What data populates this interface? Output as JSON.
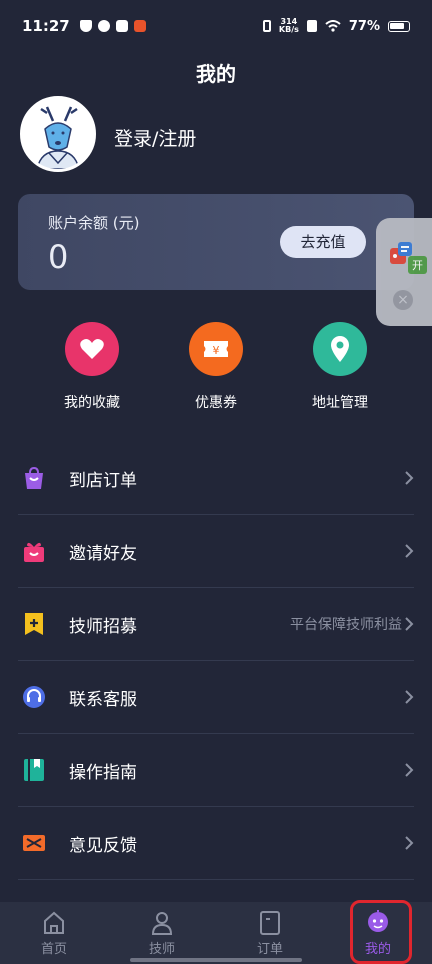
{
  "status_bar": {
    "time": "11:27",
    "net_speed_value": "314",
    "net_speed_unit": "KB/s",
    "battery": "77%"
  },
  "header": {
    "title": "我的"
  },
  "profile": {
    "login_label": "登录/注册"
  },
  "balance": {
    "label": "账户余额 (元)",
    "value": "0",
    "recharge_label": "去充值"
  },
  "floating_widget": {
    "badge": "开"
  },
  "quick_actions": [
    {
      "label": "我的收藏",
      "icon": "heart-icon",
      "color": "#e8346a"
    },
    {
      "label": "优惠券",
      "icon": "coupon-icon",
      "color": "#f46a1f"
    },
    {
      "label": "地址管理",
      "icon": "location-pin-icon",
      "color": "#2fb99a"
    }
  ],
  "menu": [
    {
      "label": "到店订单",
      "hint": "",
      "icon": "shopping-bag-icon",
      "color": "#9b5de5"
    },
    {
      "label": "邀请好友",
      "hint": "",
      "icon": "gift-icon",
      "color": "#ef3b7a"
    },
    {
      "label": "技师招募",
      "hint": "平台保障技师利益",
      "icon": "bookmark-plus-icon",
      "color": "#f4c01e"
    },
    {
      "label": "联系客服",
      "hint": "",
      "icon": "headset-icon",
      "color": "#4e6ee6"
    },
    {
      "label": "操作指南",
      "hint": "",
      "icon": "book-icon",
      "color": "#1fb39a"
    },
    {
      "label": "意见反馈",
      "hint": "",
      "icon": "envelope-icon",
      "color": "#f36b2a"
    }
  ],
  "tabs": [
    {
      "label": "首页",
      "icon": "home-icon",
      "active": false
    },
    {
      "label": "技师",
      "icon": "person-icon",
      "active": false
    },
    {
      "label": "订单",
      "icon": "order-icon",
      "active": false
    },
    {
      "label": "我的",
      "icon": "robot-face-icon",
      "active": true
    }
  ]
}
